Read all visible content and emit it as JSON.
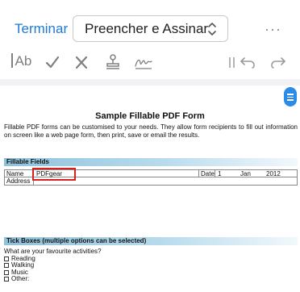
{
  "topbar": {
    "finish_label": "Terminar",
    "mode_value": "Preencher e Assinar",
    "more_label": "···"
  },
  "toolbar": {
    "text_tool_label": "Ab",
    "icons": [
      "text-icon",
      "checkmark-icon",
      "cross-icon",
      "stamp-icon",
      "signature-icon",
      "pause-icon",
      "undo-icon",
      "redo-icon"
    ]
  },
  "colors": {
    "accent": "#1f7ad6",
    "highlight": "#d92020",
    "section": "#8fc1d9"
  },
  "document": {
    "title": "Sample Fillable PDF Form",
    "intro": "Fillable PDF forms can be customised to your needs. They allow form recipients to fill out information on screen like a web page form, then print, save or email the results.",
    "section1": "Fillable Fields",
    "form": {
      "name_label": "Name",
      "name_value": "PDFgear",
      "date_label": "Date",
      "day": "1",
      "month": "Jan",
      "year": "2012",
      "address_label": "Address"
    },
    "section2": "Tick Boxes (multiple options can be selected)",
    "tick_question": "What are your favourite activities?",
    "tick_options": [
      "Reading",
      "Walking",
      "Music",
      "Other:"
    ]
  }
}
